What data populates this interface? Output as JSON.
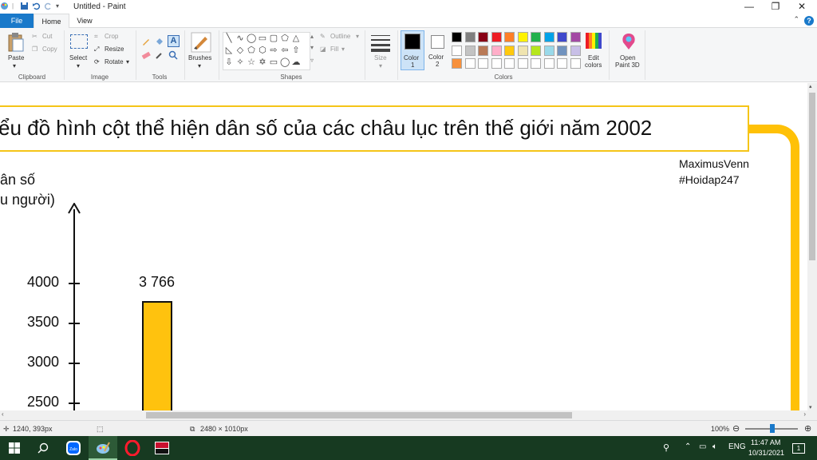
{
  "window": {
    "title": "Untitled - Paint"
  },
  "tabs": {
    "file": "File",
    "home": "Home",
    "view": "View"
  },
  "ribbon": {
    "clipboard": {
      "paste": "Paste",
      "cut": "Cut",
      "copy": "Copy",
      "group": "Clipboard"
    },
    "image": {
      "select": "Select",
      "crop": "Crop",
      "resize": "Resize",
      "rotate": "Rotate",
      "group": "Image"
    },
    "tools": {
      "group": "Tools"
    },
    "brushes": {
      "label": "Brushes"
    },
    "shapes": {
      "outline": "Outline",
      "fill": "Fill",
      "group": "Shapes"
    },
    "size": {
      "label": "Size"
    },
    "colors": {
      "color1": "Color",
      "color1_num": "1",
      "color2": "Color",
      "color2_num": "2",
      "edit": "Edit",
      "edit2": "colors",
      "group": "Colors",
      "palette_row1": [
        "#000000",
        "#7f7f7f",
        "#880015",
        "#ed1c24",
        "#ff7f27",
        "#fff200",
        "#22b14c",
        "#00a2e8",
        "#3f48cc",
        "#a349a4"
      ],
      "palette_row2": [
        "#ffffff",
        "#c3c3c3",
        "#b97a57",
        "#ffaec9",
        "#ffc90e",
        "#efe4b0",
        "#b5e61d",
        "#99d9ea",
        "#7092be",
        "#c8bfe7"
      ],
      "palette_row3": [
        "#f7913d",
        "#ffffff",
        "#ffffff",
        "#ffffff",
        "#ffffff",
        "#ffffff",
        "#ffffff",
        "#ffffff",
        "#ffffff",
        "#ffffff"
      ]
    },
    "paint3d": {
      "line1": "Open",
      "line2": "Paint 3D"
    }
  },
  "canvas": {
    "title": "ểu đồ hình cột thể hiện dân số của các châu lục trên thế giới năm 2002",
    "author": "MaximusVenn",
    "tag": "#Hoidap247",
    "ylabel_line1": "ân số",
    "ylabel_line2": "u người)",
    "ticks": [
      "4000",
      "3500",
      "3000",
      "2500"
    ],
    "bar_label": "3 766"
  },
  "chart_data": {
    "type": "bar",
    "title": "ểu đồ hình cột thể hiện dân số của các châu lục trên thế giới năm 2002",
    "ylabel": "ân số (u người)",
    "yticks": [
      4000,
      3500,
      3000,
      2500
    ],
    "values": [
      3766
    ],
    "data_labels": [
      "3 766"
    ],
    "bar_color": "#ffc20e"
  },
  "statusbar": {
    "cursor": "1240, 393px",
    "size": "2480 × 1010px",
    "zoom": "100%"
  },
  "taskbar": {
    "lang": "ENG",
    "time": "11:47 AM",
    "date": "10/31/2021",
    "notif_count": "1"
  }
}
